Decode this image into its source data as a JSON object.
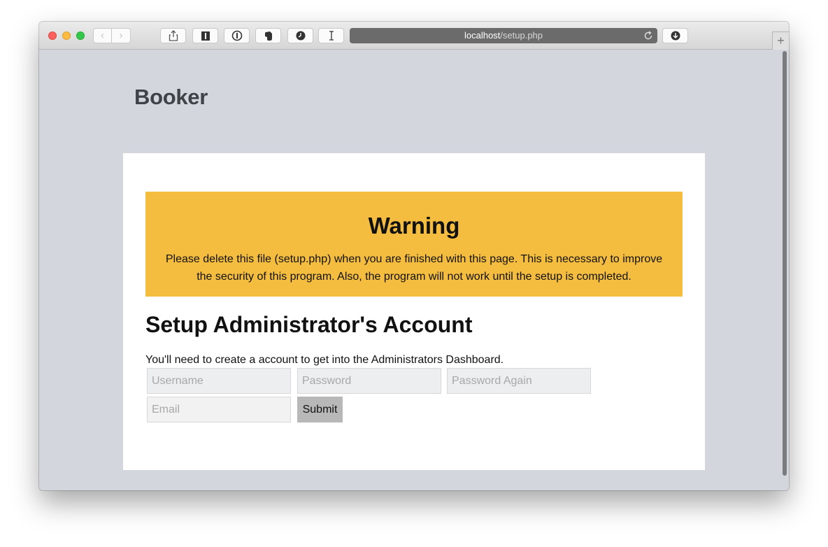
{
  "browser": {
    "url_host": "localhost",
    "url_path": "/setup.php",
    "back_glyph": "‹",
    "forward_glyph": "›",
    "new_tab_glyph": "+",
    "icons": [
      "share-icon",
      "reader-icon",
      "password-manager-icon",
      "evernote-icon",
      "history-icon",
      "text-cursor-icon",
      "reload-icon",
      "download-icon"
    ]
  },
  "site": {
    "brand": "Booker"
  },
  "warning": {
    "title": "Warning",
    "text": "Please delete this file (setup.php) when you are finished with this page. This is necessary to improve the security of this program. Also, the program will not work until the setup is completed.",
    "color": "#f4bd3f"
  },
  "setup": {
    "title": "Setup Administrator's Account",
    "description": "You'll need to create a account to get into the Administrators Dashboard.",
    "fields": {
      "username_placeholder": "Username",
      "password_placeholder": "Password",
      "password_again_placeholder": "Password Again",
      "email_placeholder": "Email"
    },
    "submit_label": "Submit"
  }
}
